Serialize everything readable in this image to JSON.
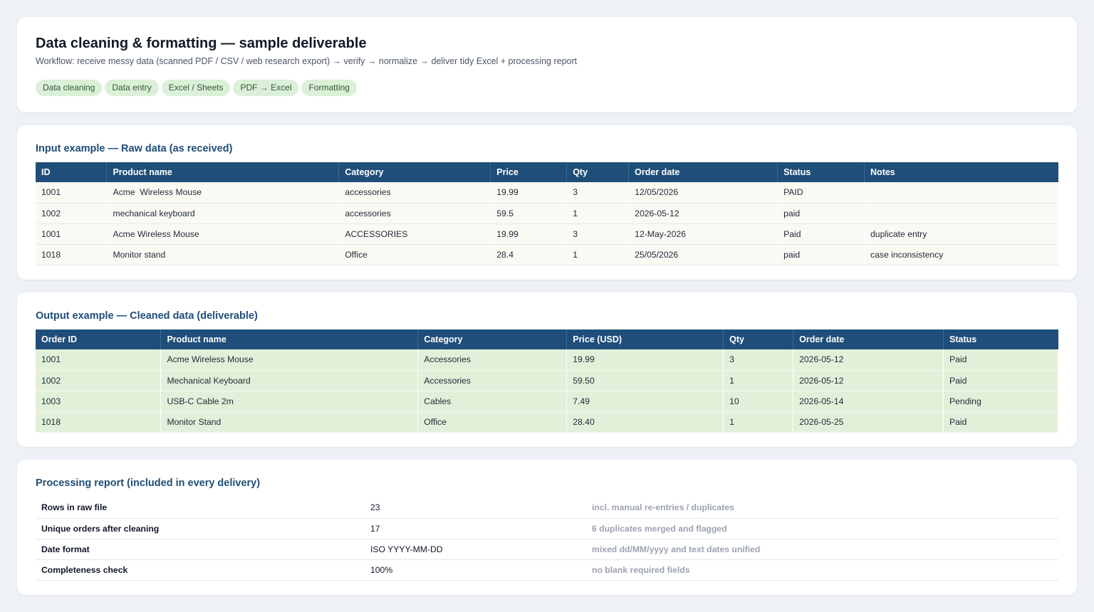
{
  "header": {
    "title": "Data cleaning & formatting — sample deliverable",
    "subtitle": "Workflow: receive messy data (scanned PDF / CSV / web research export) → verify → normalize → deliver tidy Excel + processing report",
    "tags": [
      "Data cleaning",
      "Data entry",
      "Excel / Sheets",
      "PDF → Excel",
      "Formatting"
    ]
  },
  "raw": {
    "title": "Input example — Raw data (as received)",
    "columns": [
      "ID",
      "Product name",
      "Category",
      "Price",
      "Qty",
      "Order date",
      "Status",
      "Notes"
    ],
    "rows": [
      [
        "1001",
        "Acme  Wireless Mouse",
        "accessories",
        "19.99",
        "3",
        "12/05/2026",
        "PAID",
        ""
      ],
      [
        "1002",
        "mechanical keyboard",
        "accessories",
        "59.5",
        "1",
        "2026-05-12",
        "paid",
        ""
      ],
      [
        "1001",
        "Acme Wireless Mouse",
        "ACCESSORIES",
        "19.99",
        "3",
        "12-May-2026",
        "Paid",
        "duplicate entry"
      ],
      [
        "1018",
        "Monitor stand",
        "Office",
        "28.4",
        "1",
        "25/05/2026",
        "paid",
        "case inconsistency"
      ]
    ]
  },
  "clean": {
    "title": "Output example — Cleaned data (deliverable)",
    "columns": [
      "Order ID",
      "Product name",
      "Category",
      "Price (USD)",
      "Qty",
      "Order date",
      "Status"
    ],
    "rows": [
      [
        "1001",
        "Acme Wireless Mouse",
        "Accessories",
        "19.99",
        "3",
        "2026-05-12",
        "Paid"
      ],
      [
        "1002",
        "Mechanical Keyboard",
        "Accessories",
        "59.50",
        "1",
        "2026-05-12",
        "Paid"
      ],
      [
        "1003",
        "USB-C Cable 2m",
        "Cables",
        "7.49",
        "10",
        "2026-05-14",
        "Pending"
      ],
      [
        "1018",
        "Monitor Stand",
        "Office",
        "28.40",
        "1",
        "2026-05-25",
        "Paid"
      ]
    ]
  },
  "report": {
    "title": "Processing report (included in every delivery)",
    "rows": [
      {
        "label": "Rows in raw file",
        "value": "23",
        "note": "incl. manual re-entries / duplicates"
      },
      {
        "label": "Unique orders after cleaning",
        "value": "17",
        "note": "6 duplicates merged and flagged"
      },
      {
        "label": "Date format",
        "value": "ISO YYYY-MM-DD",
        "note": "mixed dd/MM/yyyy and text dates unified"
      },
      {
        "label": "Completeness check",
        "value": "100%",
        "note": "no blank required fields"
      }
    ]
  },
  "colors": {
    "accent": "#1f4e79",
    "tag_bg": "#dcefd9",
    "clean_row_bg": "#e2f0d9",
    "raw_row_bg": "#faf9f3"
  }
}
